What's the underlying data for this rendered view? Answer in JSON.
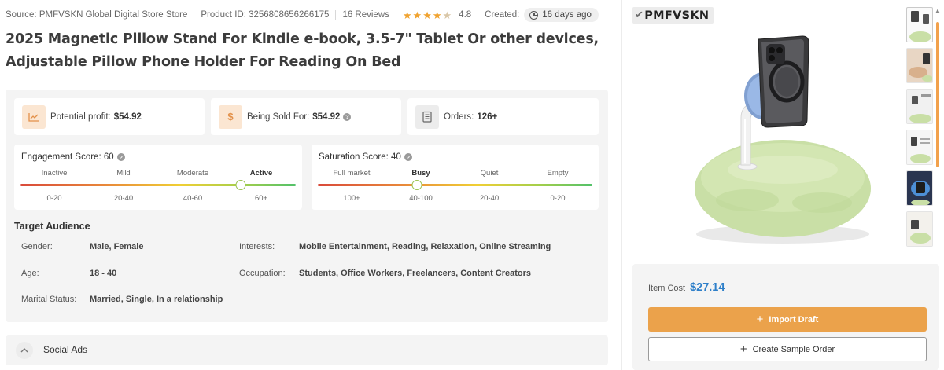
{
  "meta": {
    "source": "Source: PMFVSKN Global Digital Store Store",
    "product_id": "Product ID: 3256808656266175",
    "reviews": "16 Reviews",
    "rating": "4.8",
    "rating_stars": 4,
    "created_label": "Created:",
    "created_value": "16 days ago"
  },
  "title": "2025 Magnetic Pillow Stand For Kindle e-book, 3.5-7\" Tablet Or other devices, Adjustable Pillow Phone Holder For Reading On Bed",
  "stats": {
    "profit_label": "Potential profit:",
    "profit_value": "$54.92",
    "sold_label": "Being Sold For:",
    "sold_value": "$54.92",
    "orders_label": "Orders:",
    "orders_value": "126+"
  },
  "engagement": {
    "title": "Engagement Score: 60",
    "levels": [
      "Inactive",
      "Mild",
      "Moderate",
      "Active"
    ],
    "ranges": [
      "0-20",
      "20-40",
      "40-60",
      "60+"
    ],
    "active_index": 3,
    "knob_fraction": 0.8
  },
  "saturation": {
    "title": "Saturation Score: 40",
    "levels": [
      "Full market",
      "Busy",
      "Quiet",
      "Empty"
    ],
    "ranges": [
      "100+",
      "40-100",
      "20-40",
      "0-20"
    ],
    "active_index": 1,
    "knob_fraction": 0.36
  },
  "audience": {
    "heading": "Target Audience",
    "gender_label": "Gender:",
    "gender_value": "Male, Female",
    "interests_label": "Interests:",
    "interests_value": "Mobile Entertainment, Reading, Relaxation, Online Streaming",
    "age_label": "Age:",
    "age_value": "18 - 40",
    "occupation_label": "Occupation:",
    "occupation_value": "Students, Office Workers, Freelancers, Content Creators",
    "marital_label": "Marital Status:",
    "marital_value": "Married, Single, In a relationship"
  },
  "social_ads": {
    "label": "Social Ads"
  },
  "brand": "PMFVSKN",
  "purchase": {
    "item_cost_label": "Item Cost",
    "item_cost_value": "$27.14",
    "import_label": "Import Draft",
    "sample_label": "Create Sample Order"
  },
  "colors": {
    "accent_orange": "#eba24b",
    "price_blue": "#2e7fc9",
    "pillow_green": "#c9dfa6"
  }
}
